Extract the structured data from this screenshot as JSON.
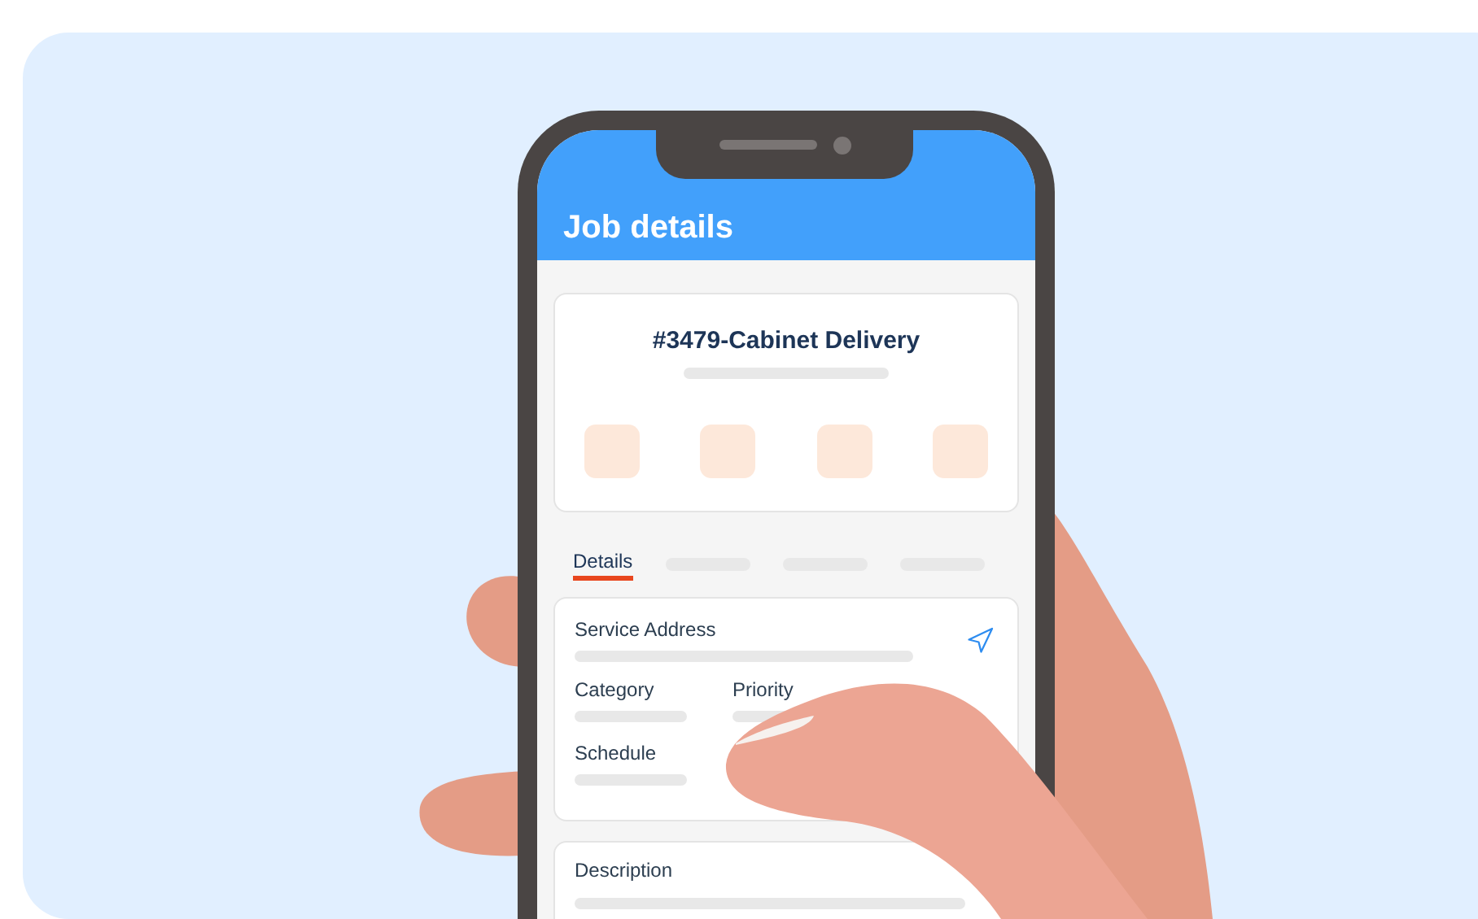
{
  "header": {
    "title": "Job details"
  },
  "job_card": {
    "title": "#3479-Cabinet Delivery"
  },
  "tabs": [
    {
      "label": "Details",
      "selected": true
    },
    {
      "selected": false
    },
    {
      "selected": false
    },
    {
      "selected": false
    }
  ],
  "details_card": {
    "fields": [
      {
        "label": "Service Address"
      },
      {
        "label": "Category"
      },
      {
        "label": "Priority"
      },
      {
        "label": "Schedule"
      }
    ]
  },
  "description_card": {
    "label": "Description"
  }
}
